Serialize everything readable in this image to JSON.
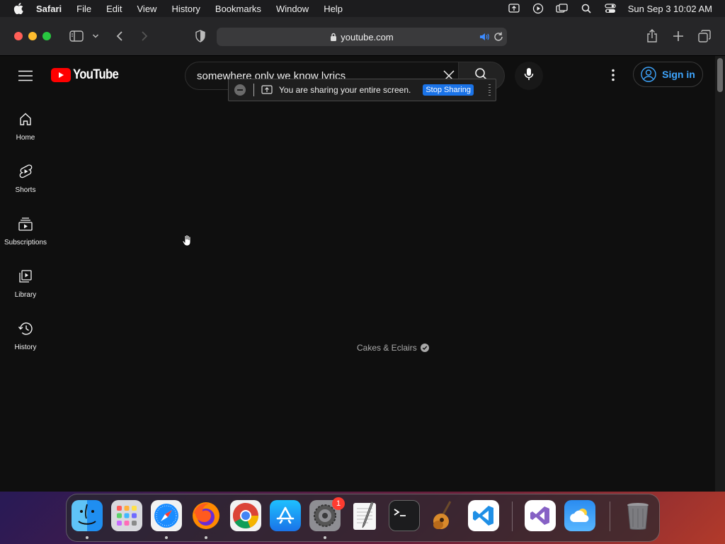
{
  "menubar": {
    "app_name": "Safari",
    "items": [
      "File",
      "Edit",
      "View",
      "History",
      "Bookmarks",
      "Window",
      "Help"
    ],
    "clock": "Sun Sep 3  10:02 AM"
  },
  "browser": {
    "url": "youtube.com"
  },
  "youtube": {
    "logo_text": "YouTube",
    "search_query": "somewhere only we know lyrics",
    "sign_in_label": "Sign in",
    "nav": [
      {
        "label": "Home",
        "icon": "home-icon"
      },
      {
        "label": "Shorts",
        "icon": "shorts-icon"
      },
      {
        "label": "Subscriptions",
        "icon": "subscriptions-icon"
      },
      {
        "label": "Library",
        "icon": "library-icon"
      },
      {
        "label": "History",
        "icon": "history-icon"
      }
    ],
    "channel_name": "Cakes & Eclairs"
  },
  "share_banner": {
    "message": "You are sharing your entire screen.",
    "stop_label": "Stop Sharing"
  },
  "dock": {
    "apps": [
      "finder-icon",
      "launchpad-icon",
      "safari-icon",
      "firefox-icon",
      "chrome-icon",
      "app-store-icon",
      "system-settings-icon",
      "textedit-icon",
      "terminal-icon",
      "garageband-icon",
      "vscode-icon",
      "visual-studio-icon",
      "weather-icon",
      "trash-icon"
    ],
    "settings_badge": "1"
  },
  "colors": {
    "youtube_red": "#ff0000",
    "sign_in_blue": "#3ea6ff",
    "stop_sharing_blue": "#1a73e8"
  }
}
